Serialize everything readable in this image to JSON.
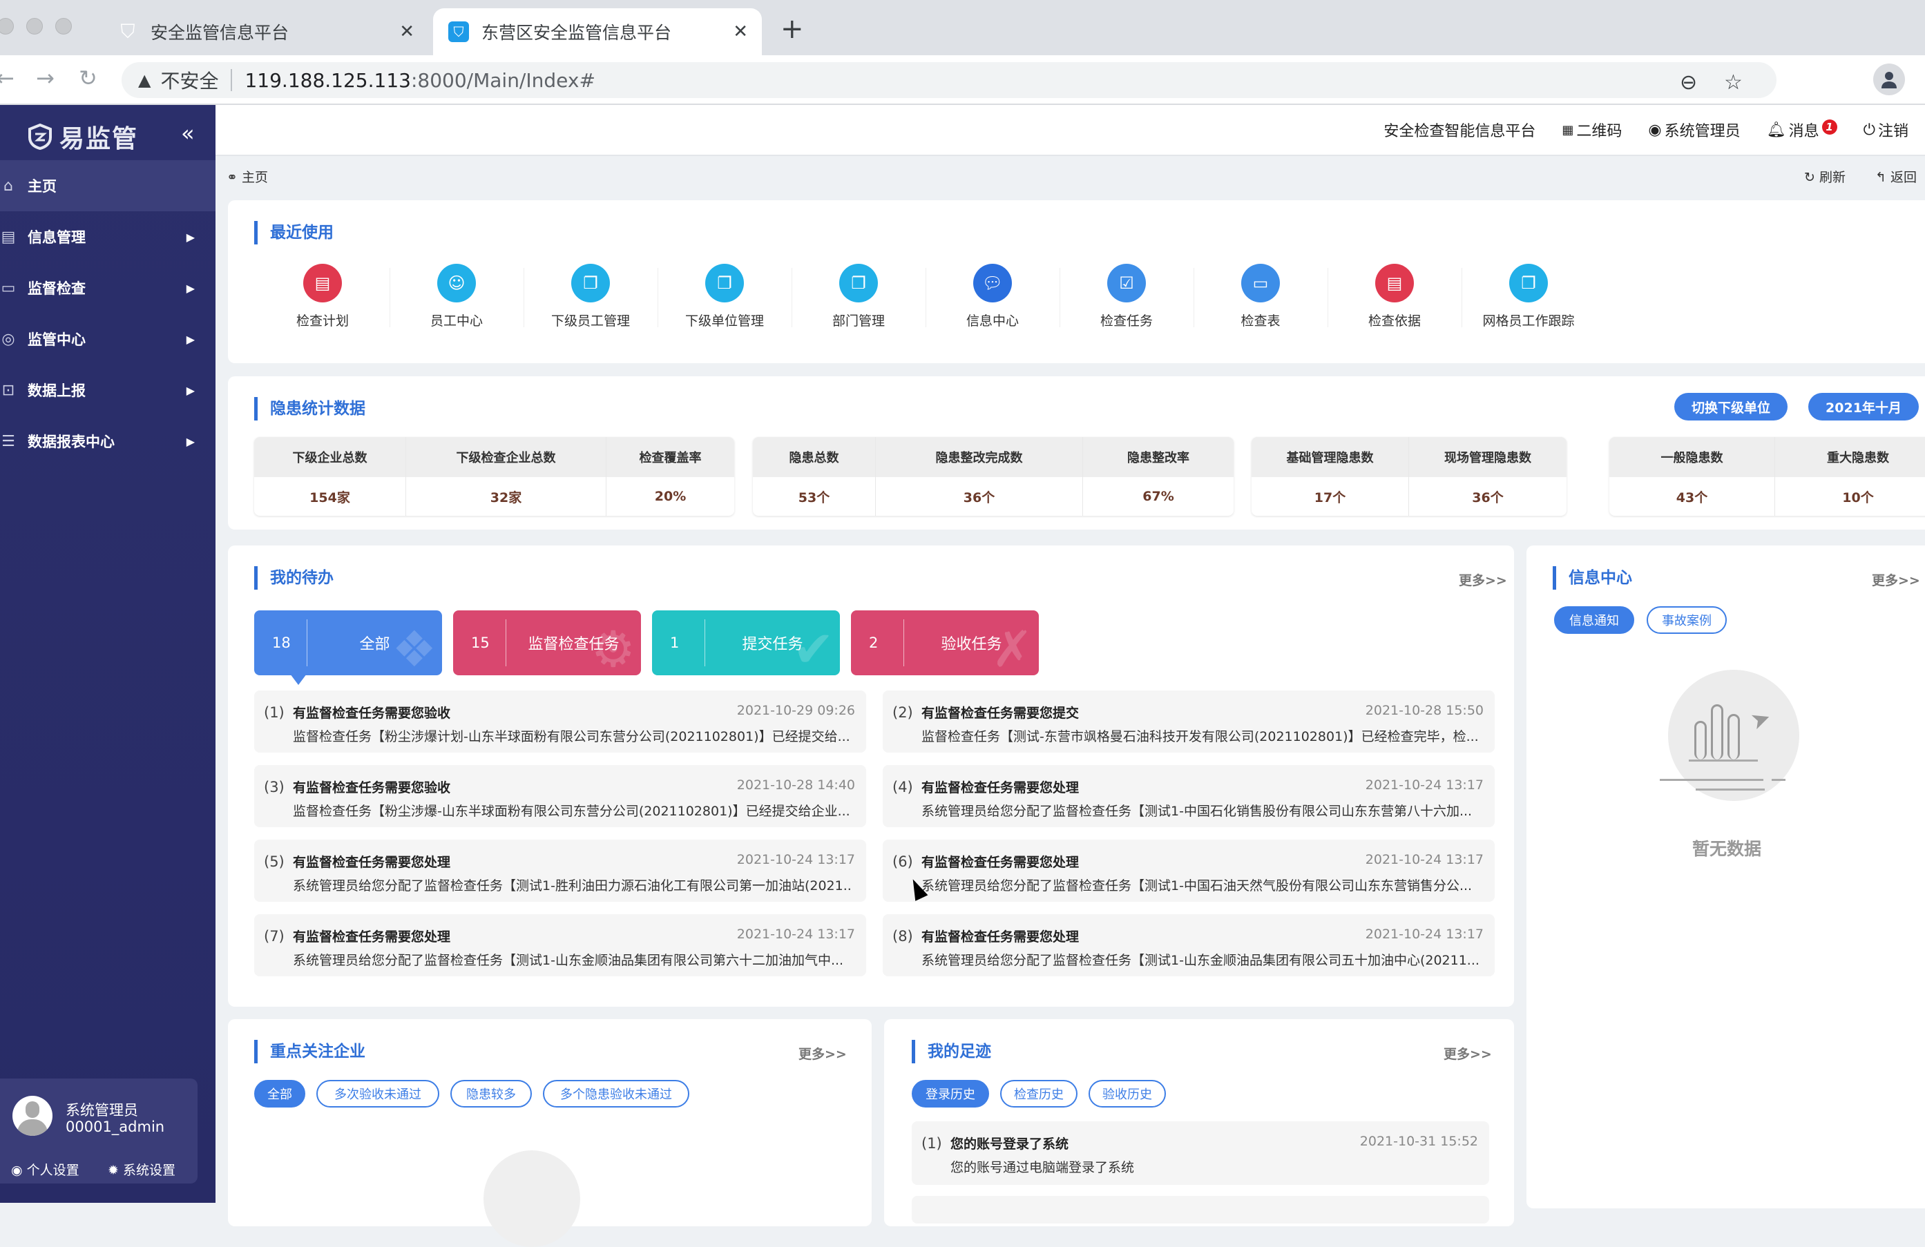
{
  "browser": {
    "tabs": [
      {
        "title": "安全监管信息平台",
        "active": false
      },
      {
        "title": "东营区安全监管信息平台",
        "active": true
      }
    ],
    "new_tab_icon": "plus-icon",
    "security_label": "不安全",
    "url_host": "119.188.125.113",
    "url_path": ":8000/Main/Index#"
  },
  "sidebar": {
    "logo": "易监管",
    "collapse_icon": "«",
    "items": [
      {
        "label": "主页",
        "icon": "home-icon",
        "active": true,
        "has_submenu": false
      },
      {
        "label": "信息管理",
        "icon": "chat-icon",
        "active": false,
        "has_submenu": true
      },
      {
        "label": "监督检查",
        "icon": "monitor-icon",
        "active": false,
        "has_submenu": true
      },
      {
        "label": "监管中心",
        "icon": "location-icon",
        "active": false,
        "has_submenu": true
      },
      {
        "label": "数据上报",
        "icon": "upload-icon",
        "active": false,
        "has_submenu": true
      },
      {
        "label": "数据报表中心",
        "icon": "report-icon",
        "active": false,
        "has_submenu": true
      }
    ],
    "user": {
      "name": "系统管理员",
      "account": "00001_admin",
      "personal_settings": "个人设置",
      "system_settings": "系统设置"
    }
  },
  "header": {
    "platform": "安全检查智能信息平台",
    "qrcode": "二维码",
    "user": "系统管理员",
    "messages": "消息",
    "message_count": "1",
    "logout": "注销"
  },
  "breadcrumb": {
    "current": "主页",
    "refresh": "刷新",
    "back": "返回"
  },
  "recent": {
    "title": "最近使用",
    "items": [
      {
        "label": "检查计划",
        "color": "#e0394f",
        "icon": "calendar-icon"
      },
      {
        "label": "员工中心",
        "color": "#22b0e8",
        "icon": "user-icon"
      },
      {
        "label": "下级员工管理",
        "color": "#22b0e8",
        "icon": "copy-icon"
      },
      {
        "label": "下级单位管理",
        "color": "#22b0e8",
        "icon": "copy-icon"
      },
      {
        "label": "部门管理",
        "color": "#22b0e8",
        "icon": "copy-icon"
      },
      {
        "label": "信息中心",
        "color": "#2b6fde",
        "icon": "message-icon"
      },
      {
        "label": "检查任务",
        "color": "#3d8ee8",
        "icon": "checklist-icon"
      },
      {
        "label": "检查表",
        "color": "#3d8ee8",
        "icon": "document-icon"
      },
      {
        "label": "检查依据",
        "color": "#e0394f",
        "icon": "file-icon"
      },
      {
        "label": "网格员工作跟踪",
        "color": "#22b0e8",
        "icon": "copy-icon"
      }
    ]
  },
  "stats": {
    "title": "隐患统计数据",
    "switch_button": "切换下级单位",
    "month_button": "2021年十月",
    "groups": [
      [
        {
          "label": "下级企业总数",
          "value": "154家"
        },
        {
          "label": "下级检查企业总数",
          "value": "32家"
        },
        {
          "label": "检查覆盖率",
          "value": "20%"
        }
      ],
      [
        {
          "label": "隐患总数",
          "value": "53个"
        },
        {
          "label": "隐患整改完成数",
          "value": "36个"
        },
        {
          "label": "隐患整改率",
          "value": "67%"
        }
      ],
      [
        {
          "label": "基础管理隐患数",
          "value": "17个"
        },
        {
          "label": "现场管理隐患数",
          "value": "36个"
        }
      ],
      [
        {
          "label": "一般隐患数",
          "value": "43个"
        },
        {
          "label": "重大隐患数",
          "value": "10个"
        }
      ]
    ]
  },
  "todo": {
    "title": "我的待办",
    "more": "更多>>",
    "tiles": [
      {
        "count": "18",
        "label": "全部",
        "color": "#4a86e8",
        "icon": "grid-icon",
        "selected": true
      },
      {
        "count": "15",
        "label": "监督检查任务",
        "color": "#d9476f",
        "icon": "gear-icon",
        "selected": false
      },
      {
        "count": "1",
        "label": "提交任务",
        "color": "#23c3c5",
        "icon": "check-doc-icon",
        "selected": false
      },
      {
        "count": "2",
        "label": "验收任务",
        "color": "#d9476f",
        "icon": "tools-icon",
        "selected": false
      }
    ],
    "items": [
      {
        "index": "(1)",
        "title": "有监督检查任务需要您验收",
        "time": "2021-10-29 09:26",
        "body": "监督检查任务【粉尘涉爆计划-山东半球面粉有限公司东营分公司(2021102801)】已经提交给..."
      },
      {
        "index": "(2)",
        "title": "有监督检查任务需要您提交",
        "time": "2021-10-28 15:50",
        "body": "监督检查任务【测试-东营市飒格曼石油科技开发有限公司(2021102801)】已经检查完毕，检..."
      },
      {
        "index": "(3)",
        "title": "有监督检查任务需要您验收",
        "time": "2021-10-28 14:40",
        "body": "监督检查任务【粉尘涉爆-山东半球面粉有限公司东营分公司(2021102801)】已经提交给企业..."
      },
      {
        "index": "(4)",
        "title": "有监督检查任务需要您处理",
        "time": "2021-10-24 13:17",
        "body": "系统管理员给您分配了监督检查任务【测试1-中国石化销售股份有限公司山东东营第八十六加..."
      },
      {
        "index": "(5)",
        "title": "有监督检查任务需要您处理",
        "time": "2021-10-24 13:17",
        "body": "系统管理员给您分配了监督检查任务【测试1-胜利油田力源石油化工有限公司第一加油站(2021..."
      },
      {
        "index": "(6)",
        "title": "有监督检查任务需要您处理",
        "time": "2021-10-24 13:17",
        "body": "系统管理员给您分配了监督检查任务【测试1-中国石油天然气股份有限公司山东东营销售分公..."
      },
      {
        "index": "(7)",
        "title": "有监督检查任务需要您处理",
        "time": "2021-10-24 13:17",
        "body": "系统管理员给您分配了监督检查任务【测试1-山东金顺油品集团有限公司第六十二加油加气中..."
      },
      {
        "index": "(8)",
        "title": "有监督检查任务需要您处理",
        "time": "2021-10-24 13:17",
        "body": "系统管理员给您分配了监督检查任务【测试1-山东金顺油品集团有限公司五十加油中心(20211..."
      }
    ]
  },
  "info_center": {
    "title": "信息中心",
    "more": "更多>>",
    "tabs": [
      {
        "label": "信息通知",
        "active": true
      },
      {
        "label": "事故案例",
        "active": false
      }
    ],
    "empty_text": "暂无数据"
  },
  "focus": {
    "title": "重点关注企业",
    "more": "更多>>",
    "tabs": [
      {
        "label": "全部",
        "active": true
      },
      {
        "label": "多次验收未通过",
        "active": false
      },
      {
        "label": "隐患较多",
        "active": false
      },
      {
        "label": "多个隐患验收未通过",
        "active": false
      }
    ]
  },
  "footprint": {
    "title": "我的足迹",
    "more": "更多>>",
    "tabs": [
      {
        "label": "登录历史",
        "active": true
      },
      {
        "label": "检查历史",
        "active": false
      },
      {
        "label": "验收历史",
        "active": false
      }
    ],
    "items": [
      {
        "index": "(1)",
        "title": "您的账号登录了系统",
        "time": "2021-10-31 15:52",
        "body": "您的账号通过电脑端登录了系统"
      }
    ]
  },
  "colors": {
    "accent": "#2f6fd6",
    "sidebar_bg": "#2b2f6b",
    "value_text": "#6b3a2a"
  }
}
